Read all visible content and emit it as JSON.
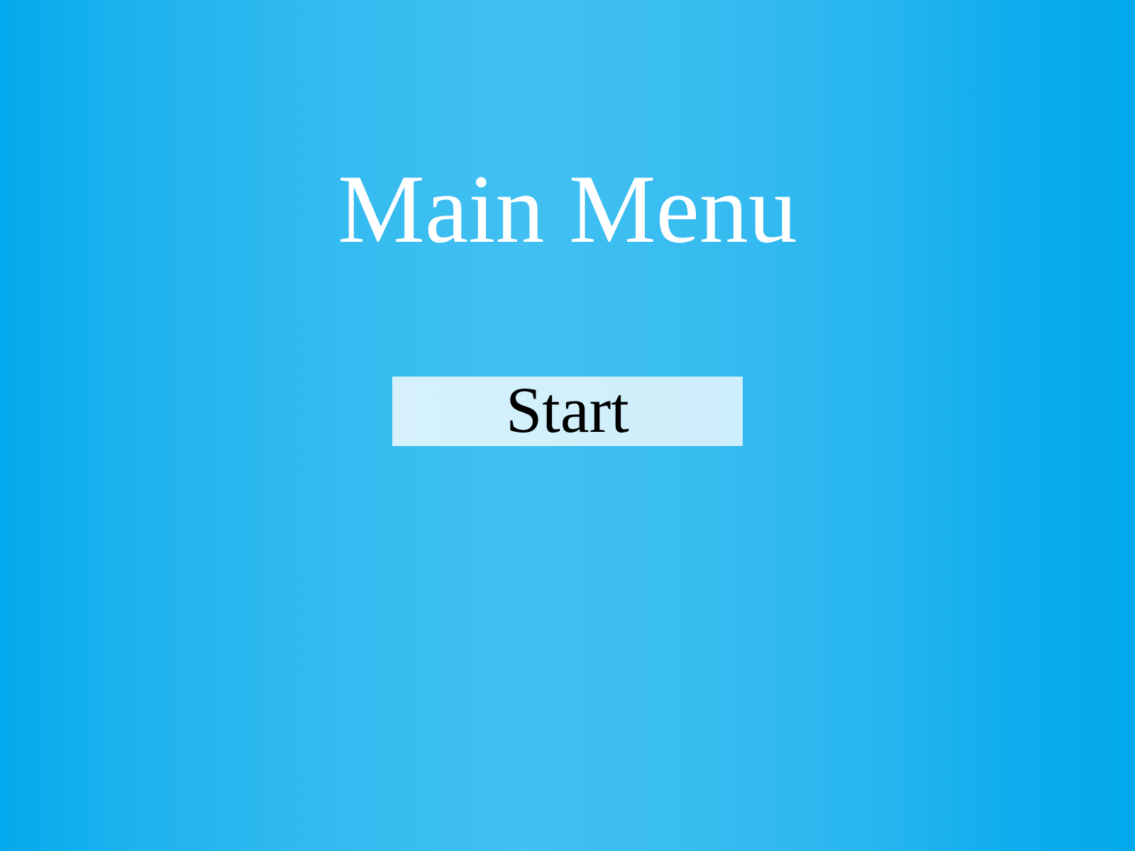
{
  "menu": {
    "title": "Main Menu",
    "start_label": "Start"
  },
  "colors": {
    "background_edge": "#03a9ed",
    "background_center": "#41c0f1",
    "title_text": "#ffffff",
    "button_fill": "#d6f1fc",
    "button_text": "#000000"
  }
}
